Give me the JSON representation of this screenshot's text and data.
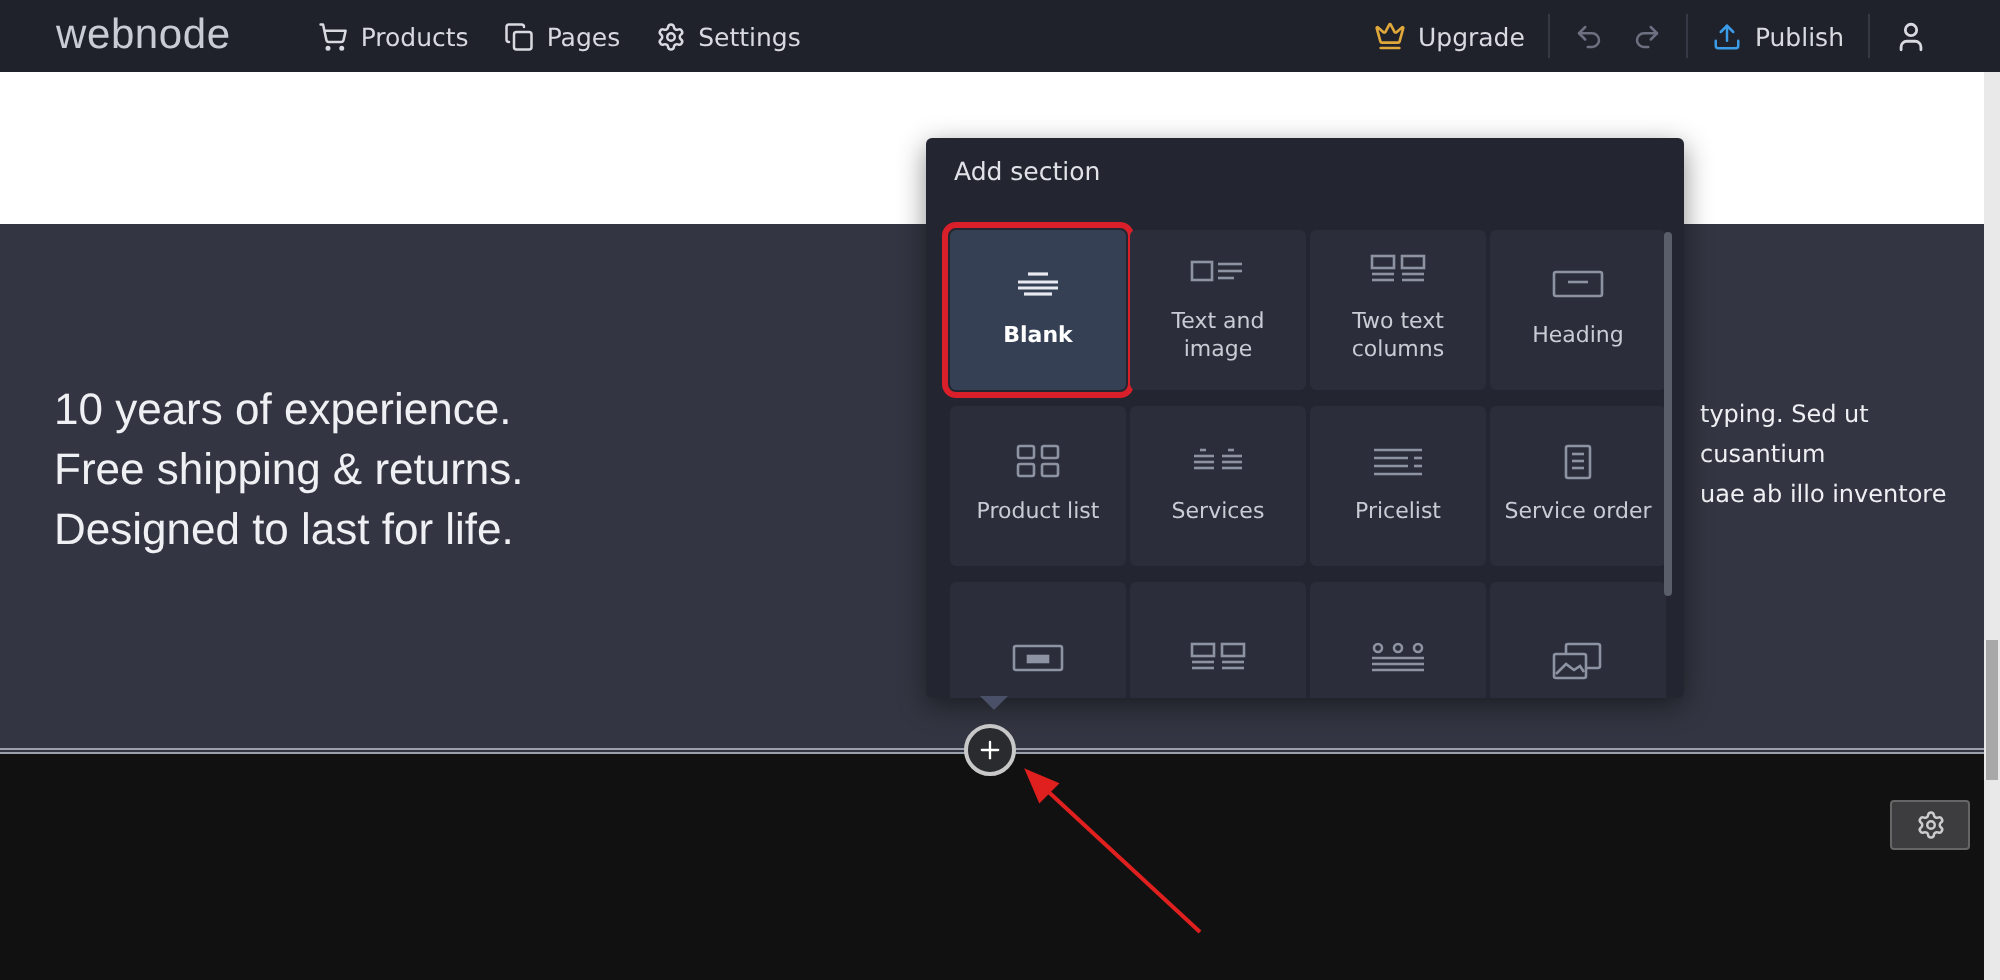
{
  "topbar": {
    "logo": "webnode",
    "nav": [
      {
        "label": "Products",
        "kind": "cart"
      },
      {
        "label": "Pages",
        "kind": "pages"
      },
      {
        "label": "Settings",
        "kind": "settings"
      }
    ],
    "upgrade": "Upgrade",
    "publish": "Publish"
  },
  "hero": {
    "lines": [
      "10 years of experience.",
      "Free shipping & returns.",
      "Designed to last for life."
    ],
    "side_text": [
      "typing. Sed ut",
      "cusantium",
      "uae ab illo inventore"
    ]
  },
  "add_section": {
    "title": "Add section",
    "items": [
      {
        "label": "Blank",
        "kind": "blank",
        "selected": true
      },
      {
        "label": "Text and image",
        "kind": "text-image",
        "selected": false
      },
      {
        "label": "Two text columns",
        "kind": "two-columns",
        "selected": false
      },
      {
        "label": "Heading",
        "kind": "heading",
        "selected": false
      },
      {
        "label": "Product list",
        "kind": "product-list",
        "selected": false
      },
      {
        "label": "Services",
        "kind": "services",
        "selected": false
      },
      {
        "label": "Pricelist",
        "kind": "pricelist",
        "selected": false
      },
      {
        "label": "Service order",
        "kind": "service-order",
        "selected": false
      },
      {
        "kind": "banner",
        "selected": false
      },
      {
        "kind": "two-columns",
        "selected": false
      },
      {
        "kind": "three-columns",
        "selected": false
      },
      {
        "kind": "photo",
        "selected": false
      }
    ]
  }
}
